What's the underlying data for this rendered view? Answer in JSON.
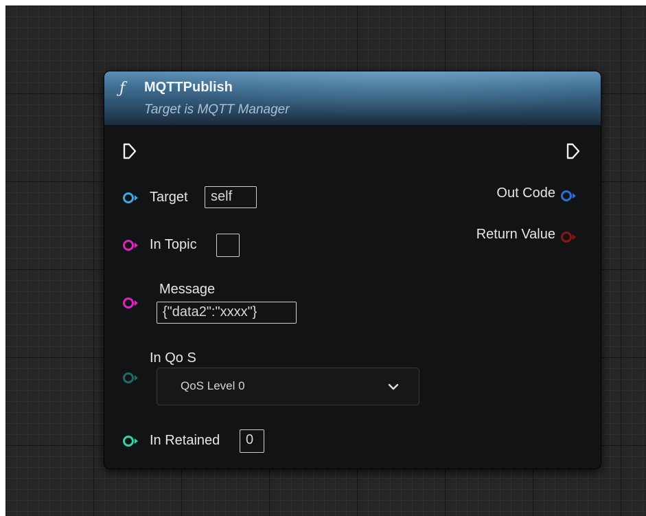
{
  "node": {
    "function_symbol": "ƒ",
    "title": "MQTTPublish",
    "subtitle": "Target is MQTT Manager"
  },
  "inputs": {
    "target": {
      "label": "Target",
      "value": "self",
      "pin_color": "#3ea8e6"
    },
    "in_topic": {
      "label": "In Topic",
      "value": "",
      "pin_color": "#e023bf"
    },
    "message": {
      "label": "Message",
      "value": "{\"data2\":\"xxxx\"}",
      "pin_color": "#e023bf"
    },
    "in_qos": {
      "label": "In Qo S",
      "selected": "QoS Level 0",
      "pin_color": "#1f6b63"
    },
    "in_retained": {
      "label": "In Retained",
      "value": "0",
      "pin_color": "#2fd3a8"
    }
  },
  "outputs": {
    "out_code": {
      "label": "Out Code",
      "pin_color": "#2a6fd6"
    },
    "return_value": {
      "label": "Return Value",
      "pin_color": "#8e1414"
    }
  },
  "colors": {
    "header_accent": "#3f6d90",
    "node_body": "#121314",
    "grid_background": "#262626"
  },
  "icons": {
    "exec_in": "exec-pin-in-icon",
    "exec_out": "exec-pin-out-icon",
    "dropdown": "chevron-down-icon"
  }
}
